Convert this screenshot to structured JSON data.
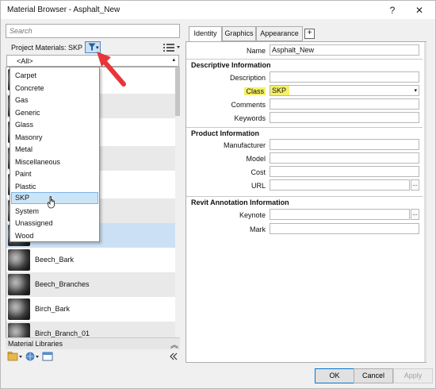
{
  "window": {
    "title": "Material Browser - Asphalt_New",
    "help_label": "?",
    "close_label": "✕"
  },
  "left": {
    "search_placeholder": "Search",
    "project_materials_label": "Project Materials: SKP",
    "filter_dropdown_value": "<All>",
    "dropdown_items": [
      "Carpet",
      "Concrete",
      "Gas",
      "Generic",
      "Glass",
      "Masonry",
      "Metal",
      "Miscellaneous",
      "Paint",
      "Plastic",
      "SKP",
      "System",
      "Unassigned",
      "Wood"
    ],
    "highlighted_item": "SKP",
    "materials": [
      "Beech_Bark",
      "Beech_Branches",
      "Birch_Bark",
      "Birch_Branch_01"
    ],
    "libraries_label": "Material Libraries"
  },
  "tabs": {
    "identity": "Identity",
    "graphics": "Graphics",
    "appearance": "Appearance",
    "add": "+"
  },
  "identity": {
    "name_label": "Name",
    "name_value": "Asphalt_New",
    "descriptive_title": "Descriptive Information",
    "description_label": "Description",
    "description_value": "",
    "class_label": "Class",
    "class_value": "SKP",
    "comments_label": "Comments",
    "comments_value": "",
    "keywords_label": "Keywords",
    "keywords_value": "",
    "product_title": "Product Information",
    "manufacturer_label": "Manufacturer",
    "manufacturer_value": "",
    "model_label": "Model",
    "model_value": "",
    "cost_label": "Cost",
    "cost_value": "",
    "url_label": "URL",
    "url_value": "",
    "url_browse": "...",
    "revit_title": "Revit Annotation Information",
    "keynote_label": "Keynote",
    "keynote_value": "",
    "keynote_browse": "...",
    "mark_label": "Mark",
    "mark_value": ""
  },
  "buttons": {
    "ok": "OK",
    "cancel": "Cancel",
    "apply": "Apply"
  },
  "colors": {
    "highlight_yellow": "#f5f06a",
    "annotation_arrow": "#e8353a",
    "selection_blue": "#cce4f7"
  }
}
